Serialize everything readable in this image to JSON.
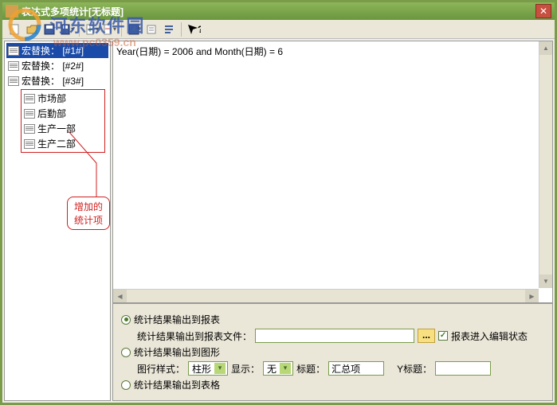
{
  "window": {
    "title": "表达式多项统计[无标题]"
  },
  "watermark": {
    "site_name": "河东软件园",
    "url": "www.pc0359.cn"
  },
  "tree": {
    "items": [
      {
        "label": "宏替换： [#1#]",
        "selected": true
      },
      {
        "label": "宏替换： [#2#]"
      },
      {
        "label": "宏替换： [#3#]"
      }
    ],
    "group": [
      {
        "label": "市场部"
      },
      {
        "label": "后勤部"
      },
      {
        "label": "生产一部"
      },
      {
        "label": "生产二部"
      }
    ]
  },
  "annotation": {
    "text": "增加的统计项"
  },
  "editor": {
    "content": "Year(日期) = 2006 and Month(日期) = 6"
  },
  "options": {
    "out_report": {
      "label": "统计结果输出到报表",
      "checked": true
    },
    "out_report_file": {
      "label": "统计结果输出到报表文件：",
      "value": ""
    },
    "browse_btn": "...",
    "edit_mode": {
      "label": "报表进入编辑状态",
      "checked": true
    },
    "out_chart": {
      "label": "统计结果输出到图形",
      "checked": false
    },
    "chart_style": {
      "label": "图行样式：",
      "value": "柱形"
    },
    "show": {
      "label": "显示：",
      "value": "无"
    },
    "title": {
      "label": "标题：",
      "value": "汇总项"
    },
    "ytitle": {
      "label": "Y标题：",
      "value": ""
    },
    "out_table": {
      "label": "统计结果输出到表格",
      "checked": false
    }
  }
}
